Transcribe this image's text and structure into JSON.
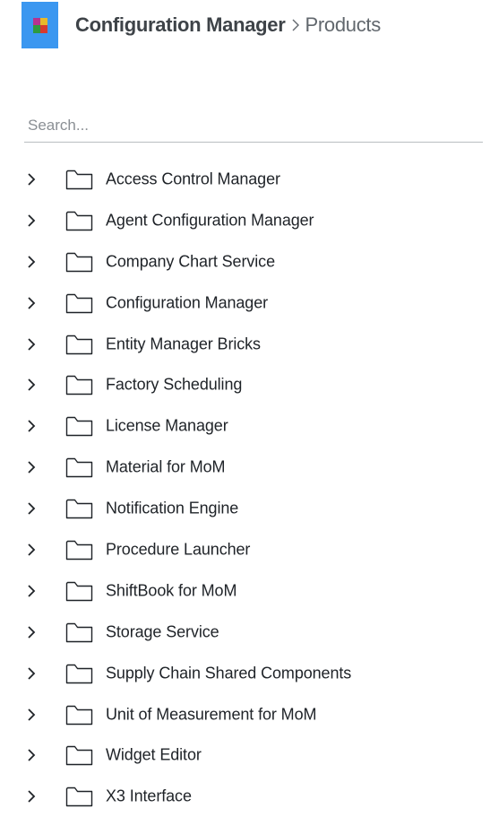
{
  "header": {
    "logo_icon": "app-logo-icon",
    "breadcrumb_root": "Configuration Manager",
    "breadcrumb_separator_icon": "chevron-right-icon",
    "breadcrumb_current": "Products",
    "colors": {
      "logo_bg": "#3b97f0"
    }
  },
  "search": {
    "placeholder": "Search...",
    "value": ""
  },
  "tree": {
    "expand_icon": "chevron-right-icon",
    "item_icon": "folder-icon",
    "items": [
      {
        "label": "Access Control Manager"
      },
      {
        "label": "Agent Configuration Manager"
      },
      {
        "label": "Company Chart Service"
      },
      {
        "label": "Configuration Manager"
      },
      {
        "label": "Entity Manager Bricks"
      },
      {
        "label": "Factory Scheduling"
      },
      {
        "label": "License Manager"
      },
      {
        "label": "Material for MoM"
      },
      {
        "label": "Notification Engine"
      },
      {
        "label": "Procedure Launcher"
      },
      {
        "label": "ShiftBook for MoM"
      },
      {
        "label": "Storage Service"
      },
      {
        "label": "Supply Chain Shared Components"
      },
      {
        "label": "Unit of Measurement for MoM"
      },
      {
        "label": "Widget Editor"
      },
      {
        "label": "X3 Interface"
      }
    ]
  }
}
